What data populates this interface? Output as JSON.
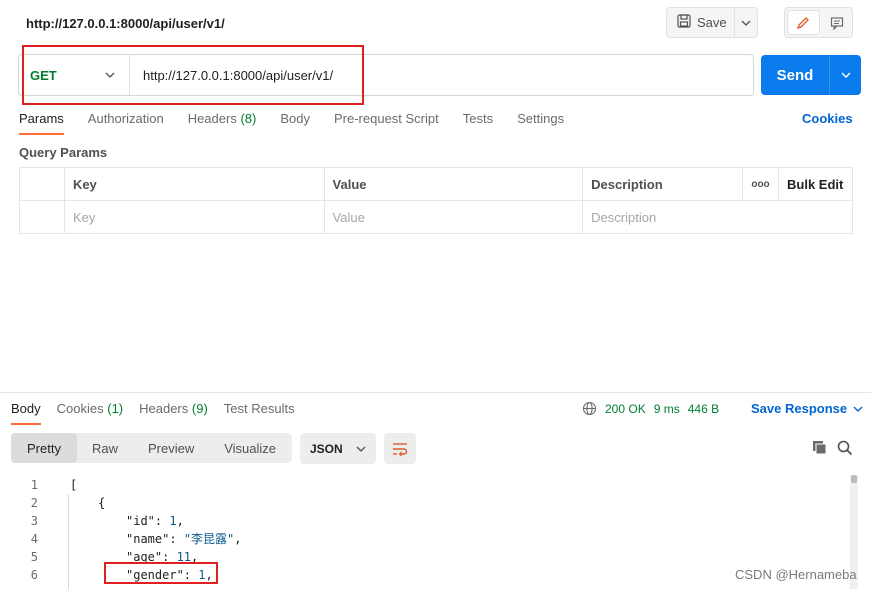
{
  "title_url": "http://127.0.0.1:8000/api/user/v1/",
  "toolbar": {
    "save_label": "Save"
  },
  "request": {
    "method": "GET",
    "url": "http://127.0.0.1:8000/api/user/v1/",
    "send_label": "Send"
  },
  "request_tabs": {
    "params": "Params",
    "authorization": "Authorization",
    "headers": "Headers",
    "headers_count": "(8)",
    "body": "Body",
    "prerequest": "Pre-request Script",
    "tests": "Tests",
    "settings": "Settings",
    "cookies": "Cookies"
  },
  "query_params": {
    "title": "Query Params",
    "col_key": "Key",
    "col_value": "Value",
    "col_description": "Description",
    "more": "ooo",
    "bulk_edit": "Bulk Edit",
    "ph_key": "Key",
    "ph_value": "Value",
    "ph_description": "Description"
  },
  "response_tabs": {
    "body": "Body",
    "cookies": "Cookies",
    "cookies_count": "(1)",
    "headers": "Headers",
    "headers_count": "(9)",
    "test_results": "Test Results"
  },
  "response_stats": {
    "status": "200 OK",
    "time": "9 ms",
    "size": "446 B",
    "save_response": "Save Response"
  },
  "format": {
    "pretty": "Pretty",
    "raw": "Raw",
    "preview": "Preview",
    "visualize": "Visualize",
    "json": "JSON"
  },
  "code_lines": [
    {
      "n": "1",
      "text": "["
    },
    {
      "n": "2",
      "text": "{"
    },
    {
      "n": "3",
      "key": "\"id\"",
      "sep": ": ",
      "val": "1",
      "end": ","
    },
    {
      "n": "4",
      "key": "\"name\"",
      "sep": ": ",
      "val": "\"李昆露\"",
      "end": ","
    },
    {
      "n": "5",
      "key": "\"age\"",
      "sep": ": ",
      "val": "11",
      "end": ","
    },
    {
      "n": "6",
      "key": "\"gender\"",
      "sep": ": ",
      "val": "1",
      "end": ","
    }
  ],
  "watermark": "CSDN @Hernameba",
  "colors": {
    "accent": "#ff6c37",
    "send": "#097bed",
    "get": "#007f31",
    "link": "#0265d2",
    "highlight": "#e02020"
  }
}
